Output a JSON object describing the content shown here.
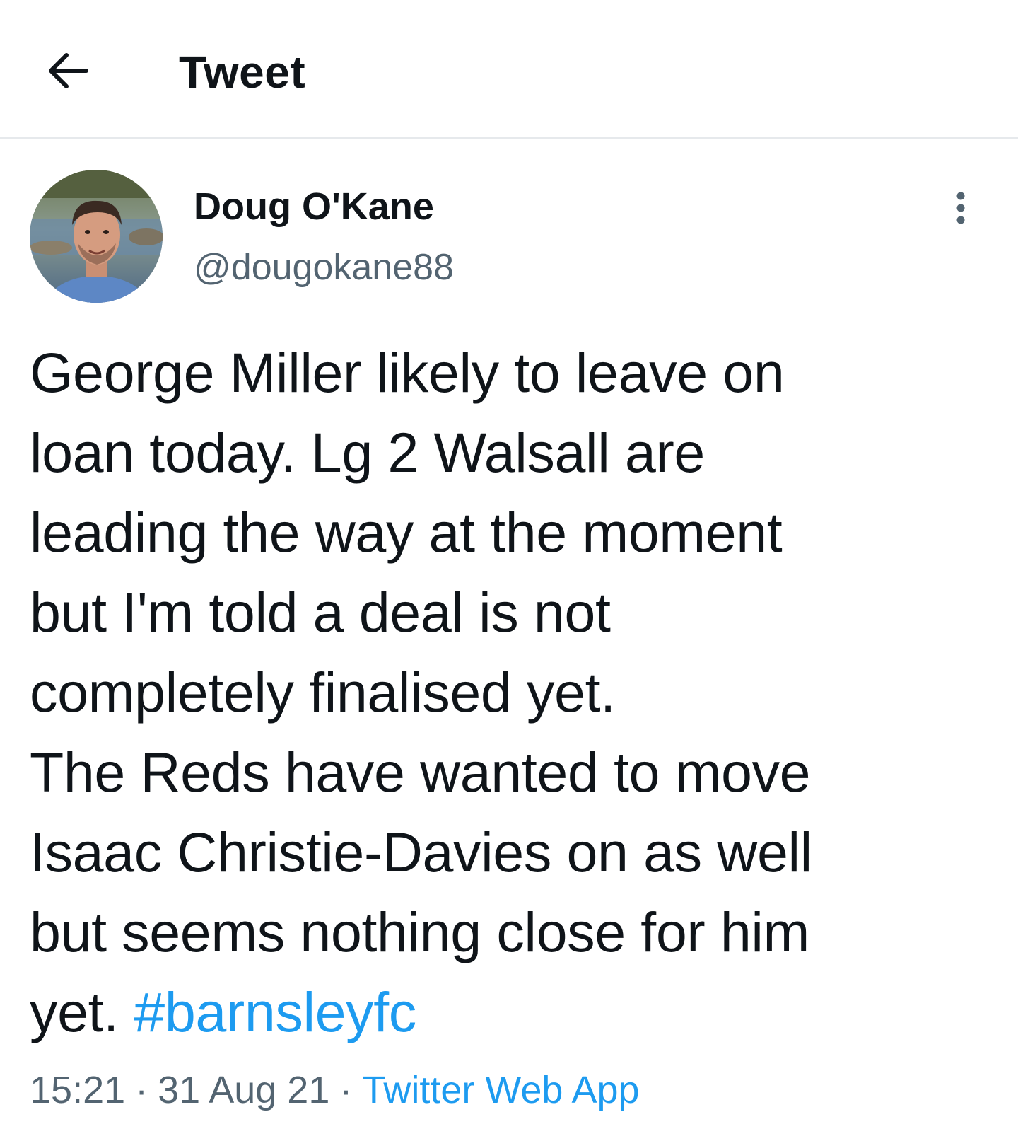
{
  "header": {
    "back_icon": "arrow-left-icon",
    "title": "Tweet"
  },
  "tweet": {
    "author": {
      "name": "Doug O'Kane",
      "handle": "@dougokane88"
    },
    "more_icon": "vertical-ellipsis-icon",
    "text_lines": [
      "George Miller likely to leave on",
      "loan today. Lg 2 Walsall are",
      "leading the way at the moment",
      "but I'm told a deal is not",
      "completely finalised yet.",
      "The Reds have wanted to move",
      "Isaac Christie-Davies on as well",
      "but seems nothing close for him",
      "yet. "
    ],
    "hashtag": "#barnsleyfc",
    "time": "15:21",
    "separator": "·",
    "date": "31 Aug 21",
    "source": "Twitter Web App"
  },
  "colors": {
    "text": "#0f1419",
    "secondary": "#536471",
    "link": "#1d9bf0",
    "divider": "#e6e9ec"
  }
}
